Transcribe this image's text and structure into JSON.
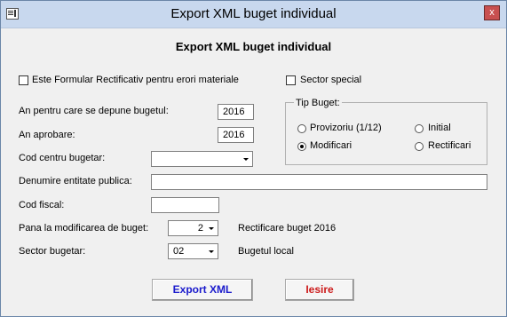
{
  "window": {
    "title": "Export XML buget individual",
    "close_label": "x"
  },
  "form": {
    "title": "Export XML buget individual"
  },
  "checkboxes": {
    "rectificativ": {
      "label": "Este Formular Rectificativ pentru erori materiale",
      "checked": false
    },
    "sector_special": {
      "label": "Sector special",
      "checked": false
    }
  },
  "fields": {
    "an_buget": {
      "label": "An pentru care se depune bugetul:",
      "value": "2016"
    },
    "an_aprobare": {
      "label": "An aprobare:",
      "value": "2016"
    },
    "cod_centru": {
      "label": "Cod centru bugetar:",
      "value": ""
    },
    "denumire": {
      "label": "Denumire entitate publica:",
      "value": ""
    },
    "cod_fiscal": {
      "label": "Cod fiscal:",
      "value": ""
    },
    "pana_la": {
      "label": "Pana la modificarea de buget:",
      "value": "2",
      "info": "Rectificare buget 2016"
    },
    "sector": {
      "label": "Sector bugetar:",
      "value": "02",
      "info": "Bugetul local"
    }
  },
  "tip_buget": {
    "legend": "Tip Buget:",
    "options": [
      {
        "label": "Provizoriu (1/12)",
        "selected": false
      },
      {
        "label": "Initial",
        "selected": false
      },
      {
        "label": "Modificari",
        "selected": true
      },
      {
        "label": "Rectificari",
        "selected": false
      }
    ]
  },
  "buttons": {
    "export": {
      "label": "Export XML",
      "color": "#1a1acc"
    },
    "exit": {
      "label": "Iesire",
      "color": "#cc1a1a"
    }
  }
}
